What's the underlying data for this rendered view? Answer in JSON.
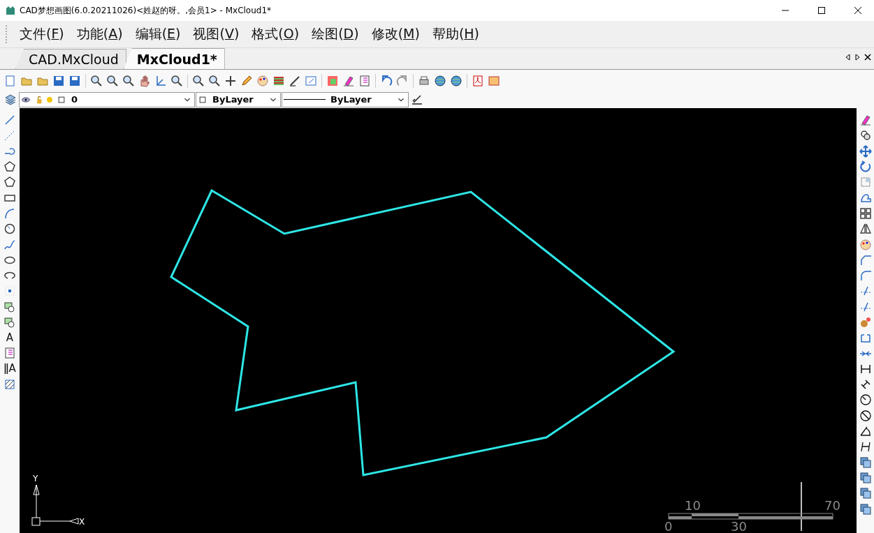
{
  "window": {
    "title": "CAD梦想画图(6.0.20211026)<姓赵的呀。,会员1> - MxCloud1*"
  },
  "menu": [
    {
      "label": "文件(",
      "mnemonic": "F",
      "suffix": ")"
    },
    {
      "label": "功能(",
      "mnemonic": "A",
      "suffix": ")"
    },
    {
      "label": "编辑(",
      "mnemonic": "E",
      "suffix": ")"
    },
    {
      "label": "视图(",
      "mnemonic": "V",
      "suffix": ")"
    },
    {
      "label": "格式(",
      "mnemonic": "O",
      "suffix": ")"
    },
    {
      "label": "绘图(",
      "mnemonic": "D",
      "suffix": ")"
    },
    {
      "label": "修改(",
      "mnemonic": "M",
      "suffix": ")"
    },
    {
      "label": "帮助(",
      "mnemonic": "H",
      "suffix": ")"
    }
  ],
  "tabs": [
    {
      "label": "CAD.MxCloud",
      "selected": false
    },
    {
      "label": "MxCloud1*",
      "selected": true
    }
  ],
  "properties_bar": {
    "layer": "0",
    "color_setting": "ByLayer",
    "linetype": "ByLayer"
  },
  "draw_toolbar": {
    "text_tool": "A",
    "mtext_tool": "ǁA"
  },
  "canvas": {
    "ucs": {
      "x_label": "X",
      "y_label": "Y"
    },
    "scale_bar": {
      "top_labels": [
        "10",
        "70"
      ],
      "bottom_labels": [
        "0",
        "30"
      ]
    }
  }
}
